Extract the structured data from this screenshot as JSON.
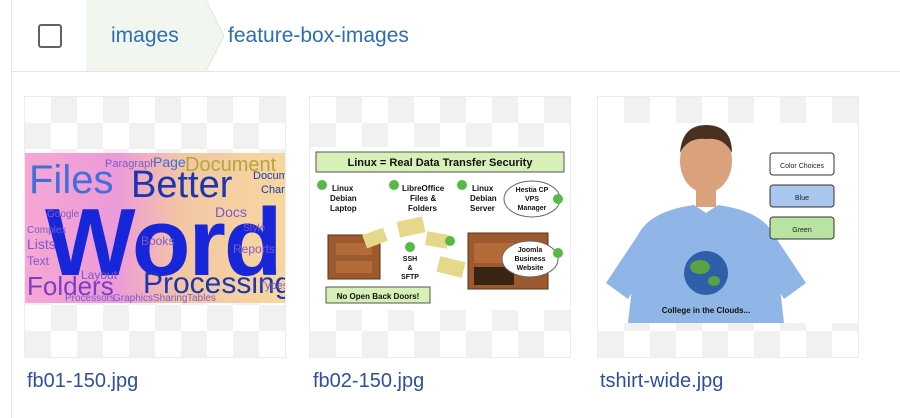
{
  "breadcrumb": {
    "items": [
      {
        "label": "images"
      },
      {
        "label": "feature-box-images"
      }
    ]
  },
  "files": [
    {
      "name": "fb01-150.jpg",
      "thumb_text": {
        "big_word": "Word",
        "words": [
          "Files",
          "Better",
          "Processing",
          "Document",
          "Folders",
          "Paragraph",
          "Page",
          "Lists",
          "Text",
          "Layout",
          "Docs",
          "Books",
          "Tables",
          "Graphics",
          "Sharing",
          "Characters",
          "Reports",
          "Types",
          "Complex",
          "Processors",
          "Google",
          "Style"
        ]
      }
    },
    {
      "name": "fb02-150.jpg",
      "thumb_text": {
        "title": "Linux = Real Data Transfer Security",
        "laptop": [
          "Linux",
          "Debian",
          "Laptop"
        ],
        "libreoffice": [
          "LibreOffice",
          "Files &",
          "Folders"
        ],
        "server": [
          "Linux",
          "Debian",
          "Server"
        ],
        "hestia": [
          "Hestia CP",
          "VPS",
          "Manager"
        ],
        "ssh": [
          "SSH",
          "&",
          "SFTP"
        ],
        "joomla": [
          "Joomla",
          "Business",
          "Website"
        ],
        "footer": "No Open Back Doors!"
      }
    },
    {
      "name": "tshirt-wide.jpg",
      "thumb_text": {
        "color_choices": "Color Choices",
        "blue": "Blue",
        "green": "Green",
        "shirt_caption": "College in the Clouds..."
      }
    }
  ],
  "colors": {
    "link": "#2f4fa0",
    "breadcrumb": "#2f6db5",
    "breadcrumb_bg": "#f1f6ee"
  }
}
